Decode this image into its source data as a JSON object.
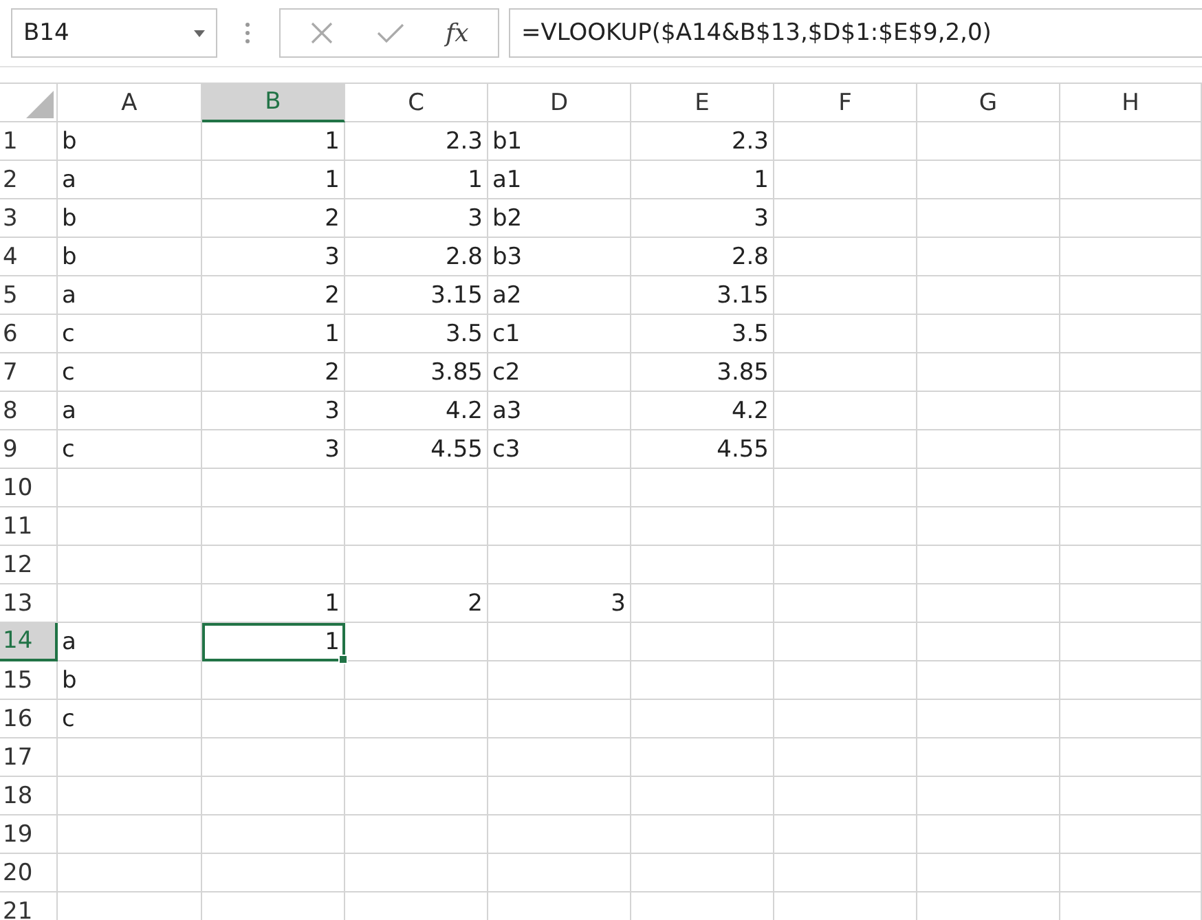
{
  "name_box": {
    "value": "B14"
  },
  "formula_bar": {
    "function_label": "fx",
    "formula": "=VLOOKUP($A14&B$13,$D$1:$E$9,2,0)"
  },
  "columns": [
    {
      "label": "A",
      "selected": false
    },
    {
      "label": "B",
      "selected": true
    },
    {
      "label": "C",
      "selected": false
    },
    {
      "label": "D",
      "selected": false
    },
    {
      "label": "E",
      "selected": false
    },
    {
      "label": "F",
      "selected": false
    },
    {
      "label": "G",
      "selected": false
    },
    {
      "label": "H",
      "selected": false
    }
  ],
  "rows": [
    {
      "label": "1",
      "selected": false,
      "cells": [
        {
          "value": "b",
          "kind": "text",
          "selected": false
        },
        {
          "value": "1",
          "kind": "number",
          "selected": false
        },
        {
          "value": "2.3",
          "kind": "number",
          "selected": false
        },
        {
          "value": "b1",
          "kind": "text",
          "selected": false
        },
        {
          "value": "2.3",
          "kind": "number",
          "selected": false
        },
        {
          "kind": "empty",
          "selected": false
        },
        {
          "kind": "empty",
          "selected": false
        },
        {
          "kind": "empty",
          "selected": false
        }
      ]
    },
    {
      "label": "2",
      "selected": false,
      "cells": [
        {
          "value": "a",
          "kind": "text",
          "selected": false
        },
        {
          "value": "1",
          "kind": "number",
          "selected": false
        },
        {
          "value": "1",
          "kind": "number",
          "selected": false
        },
        {
          "value": "a1",
          "kind": "text",
          "selected": false
        },
        {
          "value": "1",
          "kind": "number",
          "selected": false
        },
        {
          "kind": "empty",
          "selected": false
        },
        {
          "kind": "empty",
          "selected": false
        },
        {
          "kind": "empty",
          "selected": false
        }
      ]
    },
    {
      "label": "3",
      "selected": false,
      "cells": [
        {
          "value": "b",
          "kind": "text",
          "selected": false
        },
        {
          "value": "2",
          "kind": "number",
          "selected": false
        },
        {
          "value": "3",
          "kind": "number",
          "selected": false
        },
        {
          "value": "b2",
          "kind": "text",
          "selected": false
        },
        {
          "value": "3",
          "kind": "number",
          "selected": false
        },
        {
          "kind": "empty",
          "selected": false
        },
        {
          "kind": "empty",
          "selected": false
        },
        {
          "kind": "empty",
          "selected": false
        }
      ]
    },
    {
      "label": "4",
      "selected": false,
      "cells": [
        {
          "value": "b",
          "kind": "text",
          "selected": false
        },
        {
          "value": "3",
          "kind": "number",
          "selected": false
        },
        {
          "value": "2.8",
          "kind": "number",
          "selected": false
        },
        {
          "value": "b3",
          "kind": "text",
          "selected": false
        },
        {
          "value": "2.8",
          "kind": "number",
          "selected": false
        },
        {
          "kind": "empty",
          "selected": false
        },
        {
          "kind": "empty",
          "selected": false
        },
        {
          "kind": "empty",
          "selected": false
        }
      ]
    },
    {
      "label": "5",
      "selected": false,
      "cells": [
        {
          "value": "a",
          "kind": "text",
          "selected": false
        },
        {
          "value": "2",
          "kind": "number",
          "selected": false
        },
        {
          "value": "3.15",
          "kind": "number",
          "selected": false
        },
        {
          "value": "a2",
          "kind": "text",
          "selected": false
        },
        {
          "value": "3.15",
          "kind": "number",
          "selected": false
        },
        {
          "kind": "empty",
          "selected": false
        },
        {
          "kind": "empty",
          "selected": false
        },
        {
          "kind": "empty",
          "selected": false
        }
      ]
    },
    {
      "label": "6",
      "selected": false,
      "cells": [
        {
          "value": "c",
          "kind": "text",
          "selected": false
        },
        {
          "value": "1",
          "kind": "number",
          "selected": false
        },
        {
          "value": "3.5",
          "kind": "number",
          "selected": false
        },
        {
          "value": "c1",
          "kind": "text",
          "selected": false
        },
        {
          "value": "3.5",
          "kind": "number",
          "selected": false
        },
        {
          "kind": "empty",
          "selected": false
        },
        {
          "kind": "empty",
          "selected": false
        },
        {
          "kind": "empty",
          "selected": false
        }
      ]
    },
    {
      "label": "7",
      "selected": false,
      "cells": [
        {
          "value": "c",
          "kind": "text",
          "selected": false
        },
        {
          "value": "2",
          "kind": "number",
          "selected": false
        },
        {
          "value": "3.85",
          "kind": "number",
          "selected": false
        },
        {
          "value": "c2",
          "kind": "text",
          "selected": false
        },
        {
          "value": "3.85",
          "kind": "number",
          "selected": false
        },
        {
          "kind": "empty",
          "selected": false
        },
        {
          "kind": "empty",
          "selected": false
        },
        {
          "kind": "empty",
          "selected": false
        }
      ]
    },
    {
      "label": "8",
      "selected": false,
      "cells": [
        {
          "value": "a",
          "kind": "text",
          "selected": false
        },
        {
          "value": "3",
          "kind": "number",
          "selected": false
        },
        {
          "value": "4.2",
          "kind": "number",
          "selected": false
        },
        {
          "value": "a3",
          "kind": "text",
          "selected": false
        },
        {
          "value": "4.2",
          "kind": "number",
          "selected": false
        },
        {
          "kind": "empty",
          "selected": false
        },
        {
          "kind": "empty",
          "selected": false
        },
        {
          "kind": "empty",
          "selected": false
        }
      ]
    },
    {
      "label": "9",
      "selected": false,
      "cells": [
        {
          "value": "c",
          "kind": "text",
          "selected": false
        },
        {
          "value": "3",
          "kind": "number",
          "selected": false
        },
        {
          "value": "4.55",
          "kind": "number",
          "selected": false
        },
        {
          "value": "c3",
          "kind": "text",
          "selected": false
        },
        {
          "value": "4.55",
          "kind": "number",
          "selected": false
        },
        {
          "kind": "empty",
          "selected": false
        },
        {
          "kind": "empty",
          "selected": false
        },
        {
          "kind": "empty",
          "selected": false
        }
      ]
    },
    {
      "label": "10",
      "selected": false,
      "cells": [
        {
          "kind": "empty",
          "selected": false
        },
        {
          "kind": "empty",
          "selected": false
        },
        {
          "kind": "empty",
          "selected": false
        },
        {
          "kind": "empty",
          "selected": false
        },
        {
          "kind": "empty",
          "selected": false
        },
        {
          "kind": "empty",
          "selected": false
        },
        {
          "kind": "empty",
          "selected": false
        },
        {
          "kind": "empty",
          "selected": false
        }
      ]
    },
    {
      "label": "11",
      "selected": false,
      "cells": [
        {
          "kind": "empty",
          "selected": false
        },
        {
          "kind": "empty",
          "selected": false
        },
        {
          "kind": "empty",
          "selected": false
        },
        {
          "kind": "empty",
          "selected": false
        },
        {
          "kind": "empty",
          "selected": false
        },
        {
          "kind": "empty",
          "selected": false
        },
        {
          "kind": "empty",
          "selected": false
        },
        {
          "kind": "empty",
          "selected": false
        }
      ]
    },
    {
      "label": "12",
      "selected": false,
      "cells": [
        {
          "kind": "empty",
          "selected": false
        },
        {
          "kind": "empty",
          "selected": false
        },
        {
          "kind": "empty",
          "selected": false
        },
        {
          "kind": "empty",
          "selected": false
        },
        {
          "kind": "empty",
          "selected": false
        },
        {
          "kind": "empty",
          "selected": false
        },
        {
          "kind": "empty",
          "selected": false
        },
        {
          "kind": "empty",
          "selected": false
        }
      ]
    },
    {
      "label": "13",
      "selected": false,
      "cells": [
        {
          "kind": "empty",
          "selected": false
        },
        {
          "value": "1",
          "kind": "number",
          "selected": false
        },
        {
          "value": "2",
          "kind": "number",
          "selected": false
        },
        {
          "value": "3",
          "kind": "number",
          "selected": false
        },
        {
          "kind": "empty",
          "selected": false
        },
        {
          "kind": "empty",
          "selected": false
        },
        {
          "kind": "empty",
          "selected": false
        },
        {
          "kind": "empty",
          "selected": false
        }
      ]
    },
    {
      "label": "14",
      "selected": true,
      "cells": [
        {
          "value": "a",
          "kind": "text",
          "selected": false
        },
        {
          "value": "1",
          "kind": "number",
          "selected": true
        },
        {
          "kind": "empty",
          "selected": false
        },
        {
          "kind": "empty",
          "selected": false
        },
        {
          "kind": "empty",
          "selected": false
        },
        {
          "kind": "empty",
          "selected": false
        },
        {
          "kind": "empty",
          "selected": false
        },
        {
          "kind": "empty",
          "selected": false
        }
      ]
    },
    {
      "label": "15",
      "selected": false,
      "cells": [
        {
          "value": "b",
          "kind": "text",
          "selected": false
        },
        {
          "kind": "empty",
          "selected": false
        },
        {
          "kind": "empty",
          "selected": false
        },
        {
          "kind": "empty",
          "selected": false
        },
        {
          "kind": "empty",
          "selected": false
        },
        {
          "kind": "empty",
          "selected": false
        },
        {
          "kind": "empty",
          "selected": false
        },
        {
          "kind": "empty",
          "selected": false
        }
      ]
    },
    {
      "label": "16",
      "selected": false,
      "cells": [
        {
          "value": "c",
          "kind": "text",
          "selected": false
        },
        {
          "kind": "empty",
          "selected": false
        },
        {
          "kind": "empty",
          "selected": false
        },
        {
          "kind": "empty",
          "selected": false
        },
        {
          "kind": "empty",
          "selected": false
        },
        {
          "kind": "empty",
          "selected": false
        },
        {
          "kind": "empty",
          "selected": false
        },
        {
          "kind": "empty",
          "selected": false
        }
      ]
    },
    {
      "label": "17",
      "selected": false,
      "cells": [
        {
          "kind": "empty",
          "selected": false
        },
        {
          "kind": "empty",
          "selected": false
        },
        {
          "kind": "empty",
          "selected": false
        },
        {
          "kind": "empty",
          "selected": false
        },
        {
          "kind": "empty",
          "selected": false
        },
        {
          "kind": "empty",
          "selected": false
        },
        {
          "kind": "empty",
          "selected": false
        },
        {
          "kind": "empty",
          "selected": false
        }
      ]
    },
    {
      "label": "18",
      "selected": false,
      "cells": [
        {
          "kind": "empty",
          "selected": false
        },
        {
          "kind": "empty",
          "selected": false
        },
        {
          "kind": "empty",
          "selected": false
        },
        {
          "kind": "empty",
          "selected": false
        },
        {
          "kind": "empty",
          "selected": false
        },
        {
          "kind": "empty",
          "selected": false
        },
        {
          "kind": "empty",
          "selected": false
        },
        {
          "kind": "empty",
          "selected": false
        }
      ]
    },
    {
      "label": "19",
      "selected": false,
      "cells": [
        {
          "kind": "empty",
          "selected": false
        },
        {
          "kind": "empty",
          "selected": false
        },
        {
          "kind": "empty",
          "selected": false
        },
        {
          "kind": "empty",
          "selected": false
        },
        {
          "kind": "empty",
          "selected": false
        },
        {
          "kind": "empty",
          "selected": false
        },
        {
          "kind": "empty",
          "selected": false
        },
        {
          "kind": "empty",
          "selected": false
        }
      ]
    },
    {
      "label": "20",
      "selected": false,
      "cells": [
        {
          "kind": "empty",
          "selected": false
        },
        {
          "kind": "empty",
          "selected": false
        },
        {
          "kind": "empty",
          "selected": false
        },
        {
          "kind": "empty",
          "selected": false
        },
        {
          "kind": "empty",
          "selected": false
        },
        {
          "kind": "empty",
          "selected": false
        },
        {
          "kind": "empty",
          "selected": false
        },
        {
          "kind": "empty",
          "selected": false
        }
      ]
    },
    {
      "label": "21",
      "selected": false,
      "cells": [
        {
          "kind": "empty",
          "selected": false
        },
        {
          "kind": "empty",
          "selected": false
        },
        {
          "kind": "empty",
          "selected": false
        },
        {
          "kind": "empty",
          "selected": false
        },
        {
          "kind": "empty",
          "selected": false
        },
        {
          "kind": "empty",
          "selected": false
        },
        {
          "kind": "empty",
          "selected": false
        },
        {
          "kind": "empty",
          "selected": false
        }
      ]
    }
  ]
}
